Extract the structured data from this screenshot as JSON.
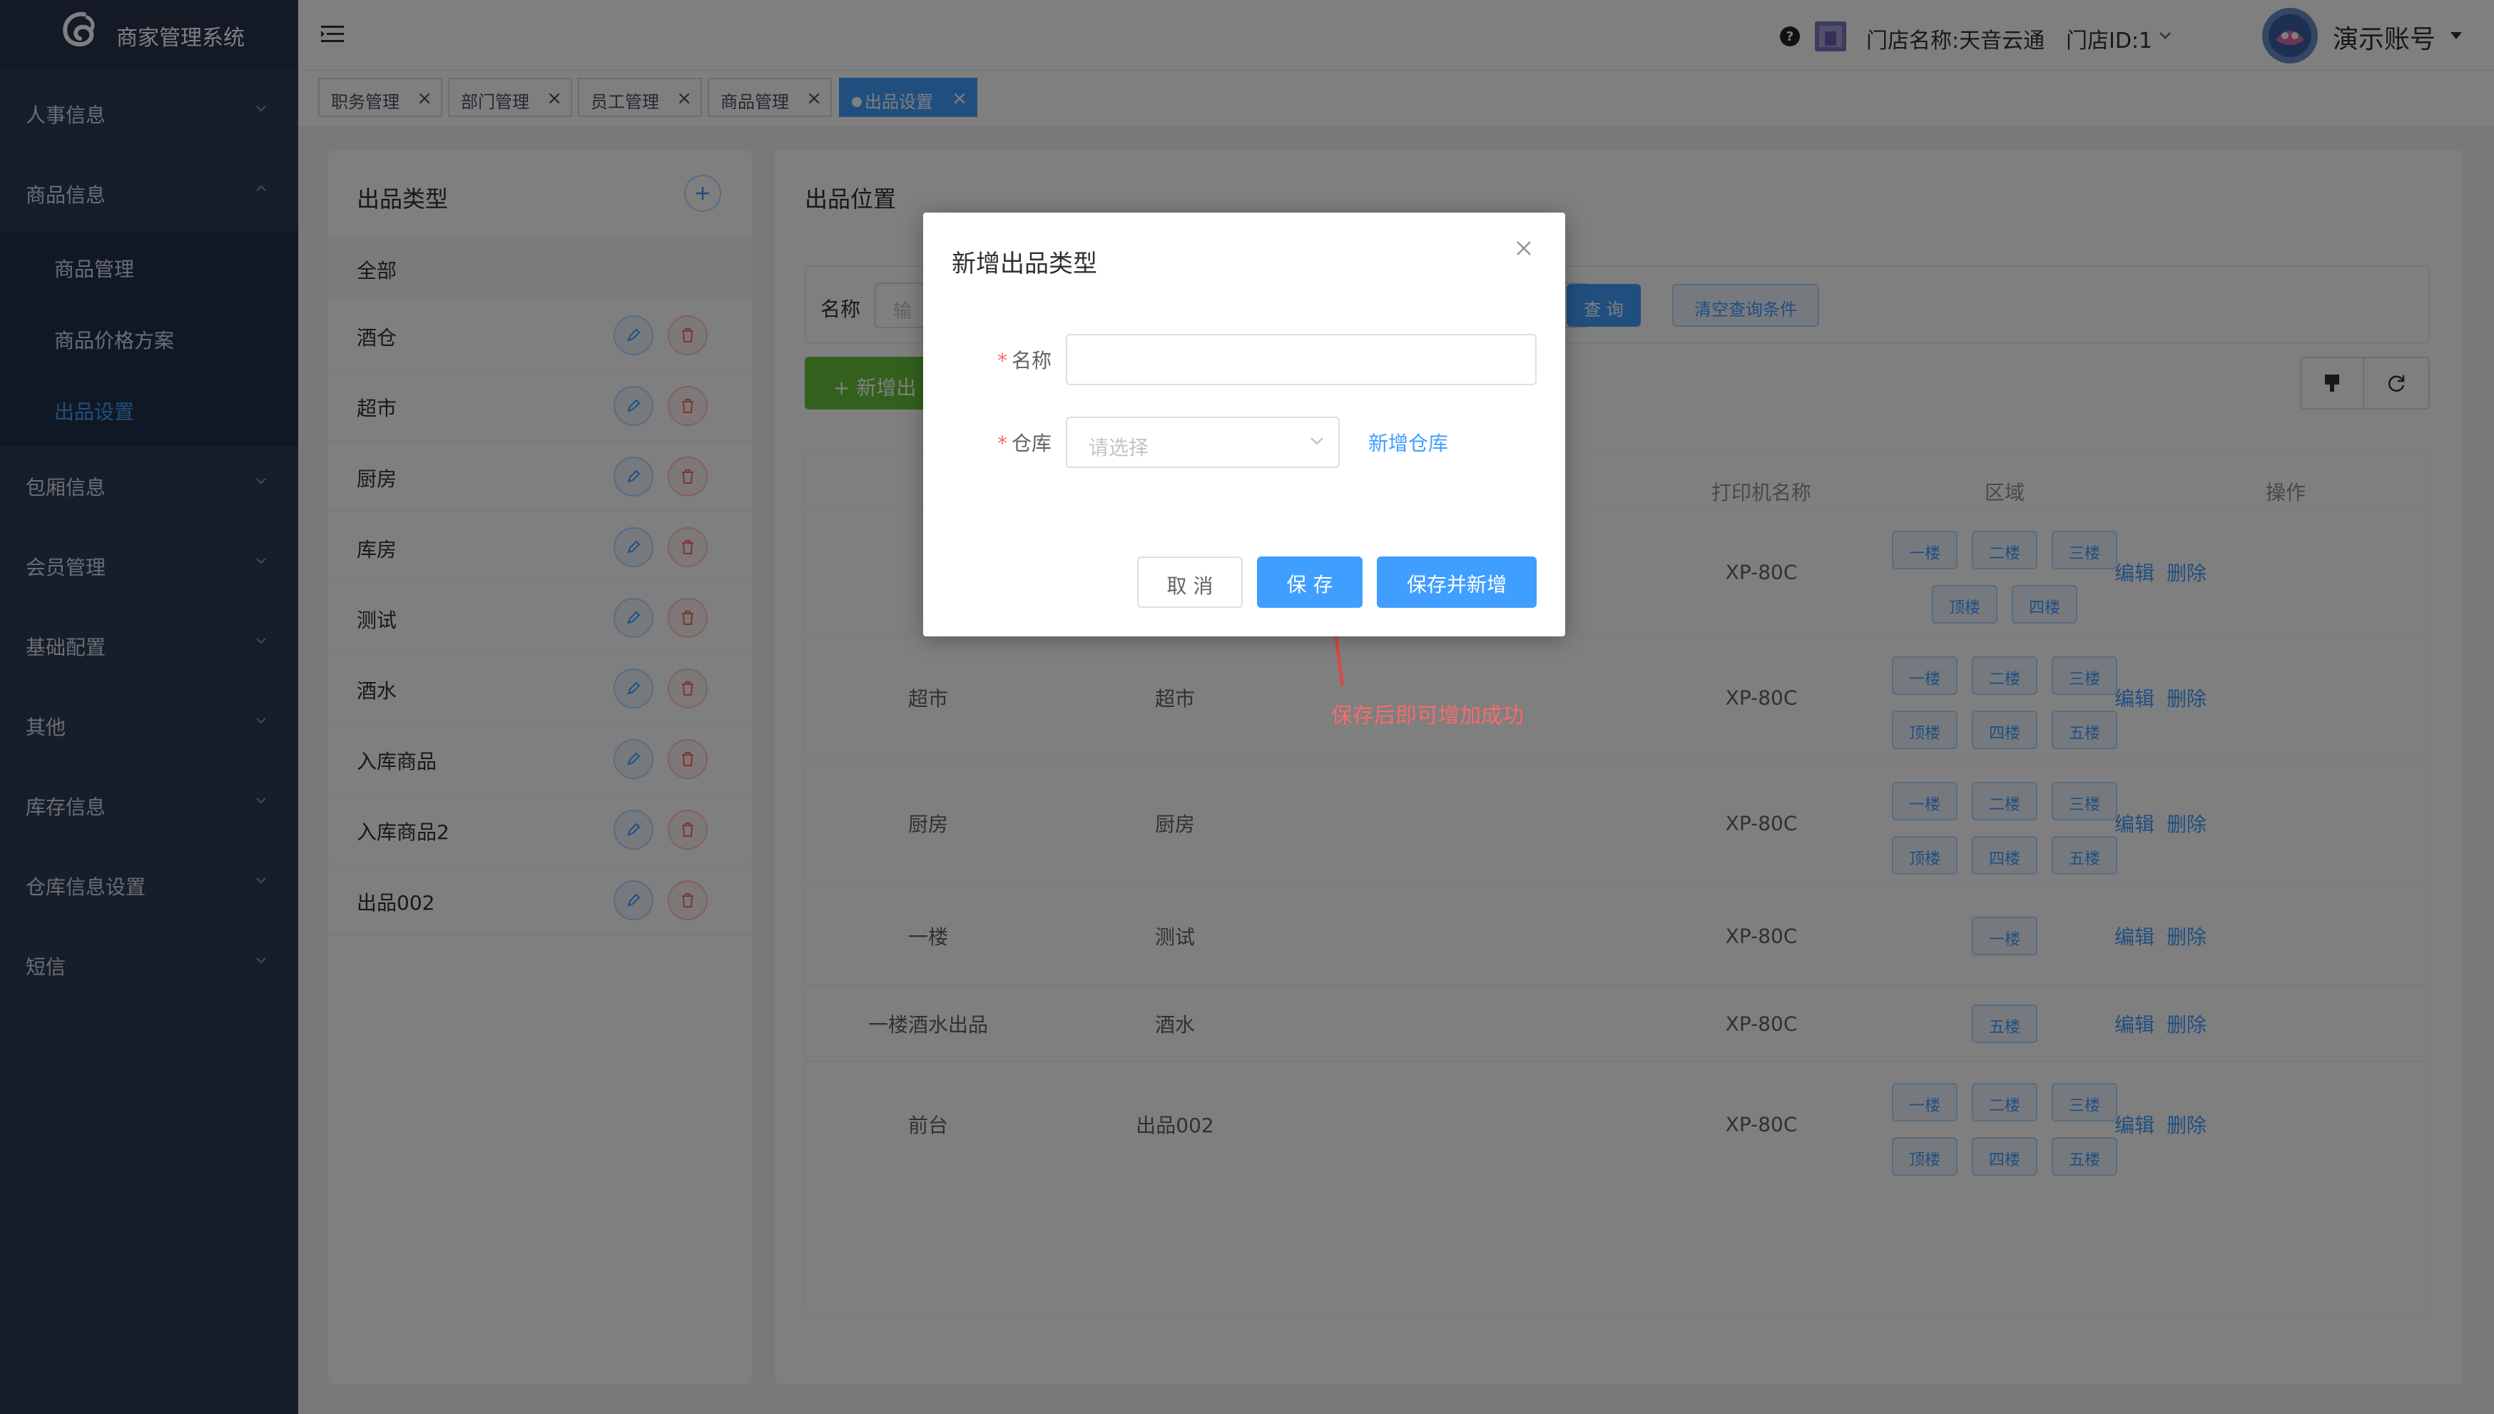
{
  "app": {
    "name": "商家管理系统"
  },
  "sidebar": {
    "menus": [
      {
        "label": "人事信息"
      },
      {
        "label": "商品信息"
      },
      {
        "label": "包厢信息"
      },
      {
        "label": "会员管理"
      },
      {
        "label": "基础配置"
      },
      {
        "label": "其他"
      },
      {
        "label": "库存信息"
      },
      {
        "label": "仓库信息设置"
      },
      {
        "label": "短信"
      }
    ],
    "submenus": [
      {
        "label": "商品管理"
      },
      {
        "label": "商品价格方案"
      },
      {
        "label": "出品设置",
        "active": true
      }
    ]
  },
  "header": {
    "store_name": "门店名称:天音云通",
    "store_id": "门店ID:1",
    "account": "演示账号"
  },
  "tags": [
    {
      "label": "职务管理"
    },
    {
      "label": "部门管理"
    },
    {
      "label": "员工管理"
    },
    {
      "label": "商品管理"
    },
    {
      "label": "出品设置",
      "active": true
    }
  ],
  "left_panel": {
    "title": "出品类型",
    "all_label": "全部",
    "categories": [
      "酒仓",
      "超市",
      "厨房",
      "库房",
      "测试",
      "酒水",
      "入库商品",
      "入库商品2",
      "出品002"
    ]
  },
  "right_panel": {
    "title": "出品位置",
    "search": {
      "label": "名称",
      "placeholder": "输",
      "query_label": "查 询",
      "clear_label": "清空查询条件"
    },
    "add_label": "新增出",
    "columns": [
      "打印机名称",
      "区域",
      "操作"
    ],
    "rows": [
      {
        "name": "",
        "type": "",
        "printer": "XP-80C",
        "zones": [
          "一楼",
          "二楼",
          "三楼",
          "顶楼",
          "四楼"
        ]
      },
      {
        "name": "超市",
        "type": "超市",
        "printer": "XP-80C",
        "zones": [
          "一楼",
          "二楼",
          "三楼",
          "顶楼",
          "四楼",
          "五楼"
        ]
      },
      {
        "name": "厨房",
        "type": "厨房",
        "printer": "XP-80C",
        "zones": [
          "一楼",
          "二楼",
          "三楼",
          "顶楼",
          "四楼",
          "五楼"
        ]
      },
      {
        "name": "一楼",
        "type": "测试",
        "printer": "XP-80C",
        "zones": [
          "一楼"
        ]
      },
      {
        "name": "一楼酒水出品",
        "type": "酒水",
        "printer": "XP-80C",
        "zones": [
          "五楼"
        ]
      },
      {
        "name": "前台",
        "type": "出品002",
        "printer": "XP-80C",
        "zones": [
          "一楼",
          "二楼",
          "三楼",
          "顶楼",
          "四楼",
          "五楼"
        ]
      }
    ],
    "edit_label": "编辑",
    "delete_label": "删除"
  },
  "dialog": {
    "title": "新增出品类型",
    "name_label": "名称",
    "name_value": "",
    "warehouse_label": "仓库",
    "warehouse_placeholder": "请选择",
    "new_warehouse_link": "新增仓库",
    "cancel_label": "取 消",
    "save_label": "保 存",
    "save_new_label": "保存并新增"
  },
  "annotation": {
    "text": "保存后即可增加成功",
    "color": "#f56c6c"
  },
  "colors": {
    "primary": "#409eff",
    "success": "#67c23a",
    "danger": "#f56c6c",
    "sidebar": "#2f3d56"
  },
  "icons": [
    "logo-icon",
    "menu-toggle-icon",
    "help-icon",
    "store-icon",
    "chevron-down-icon",
    "avatar",
    "plus-icon",
    "edit-icon",
    "delete-icon",
    "close-icon",
    "refresh-icon",
    "column-icon"
  ]
}
